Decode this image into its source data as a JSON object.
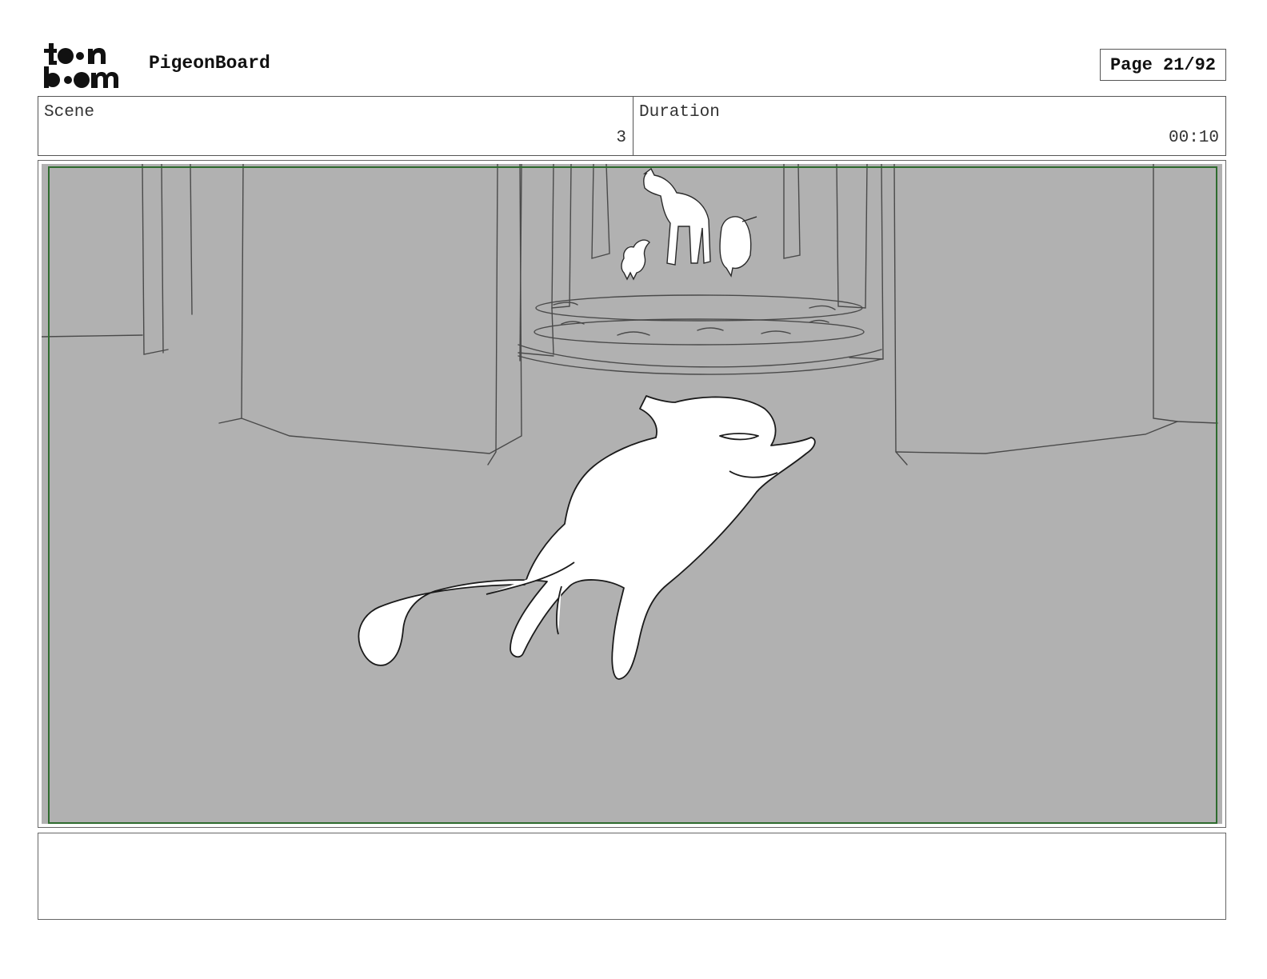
{
  "header": {
    "logo_icon": "toon-boom-logo",
    "app_title": "PigeonBoard",
    "page_indicator": "Page 21/92"
  },
  "scene_info": {
    "scene_label": "Scene",
    "scene_value": "3",
    "duration_label": "Duration",
    "duration_value": "00:10"
  },
  "panel": {
    "image_icon": "storyboard-sketch-cat-and-animals",
    "background_color": "#b1b1b1",
    "safe_frame_color": "#2e6b2e"
  },
  "notes": {
    "text": ""
  }
}
